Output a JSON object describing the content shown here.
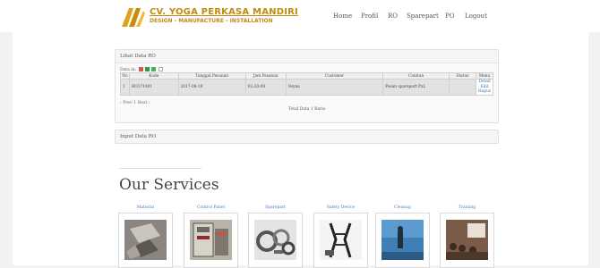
{
  "brand": {
    "title": "CV. YOGA PERKASA MANDIRI",
    "subtitle": "DESIGN - MANUFACTURE - INSTALLATION"
  },
  "nav": [
    "Home",
    "Profil",
    "RO",
    "Sparepart",
    "PO",
    "Logout"
  ],
  "ro_panel": {
    "title": "Lihat Data RO",
    "toolbar_label": "Data in:",
    "columns": [
      "No",
      "Kode",
      "Tanggal Pesanan",
      "Jam Pesanan",
      "Customer",
      "Catatan",
      "Status",
      "Menu"
    ],
    "rows": [
      {
        "no": "1",
        "kode": "RO171001",
        "tanggal": "2017-08-19",
        "jam": "02:20:08",
        "customer": "Veyna",
        "catatan": "Pesan sparepart PxL",
        "status": "",
        "menu": [
          "Detail",
          "Edit",
          "Hapus"
        ]
      }
    ],
    "pager": "‹ Prev 1 Next ›",
    "total": "Total Data 1 Baris"
  },
  "input_panel": {
    "title": "Input Data RO"
  },
  "services": {
    "heading": "Our Services",
    "items": [
      {
        "label": "Material",
        "icon": "material-photo-icon"
      },
      {
        "label": "Control Panel",
        "icon": "control-panel-photo-icon"
      },
      {
        "label": "Sparepart",
        "icon": "sparepart-photo-icon"
      },
      {
        "label": "Safety Device",
        "icon": "safety-device-photo-icon"
      },
      {
        "label": "Cleanup",
        "icon": "cleanup-photo-icon"
      },
      {
        "label": "Training",
        "icon": "training-photo-icon"
      }
    ]
  },
  "colors": {
    "brand_gold": "#c28a12",
    "link_blue": "#3b6fb0",
    "row_bg": "#e2e2e2"
  }
}
